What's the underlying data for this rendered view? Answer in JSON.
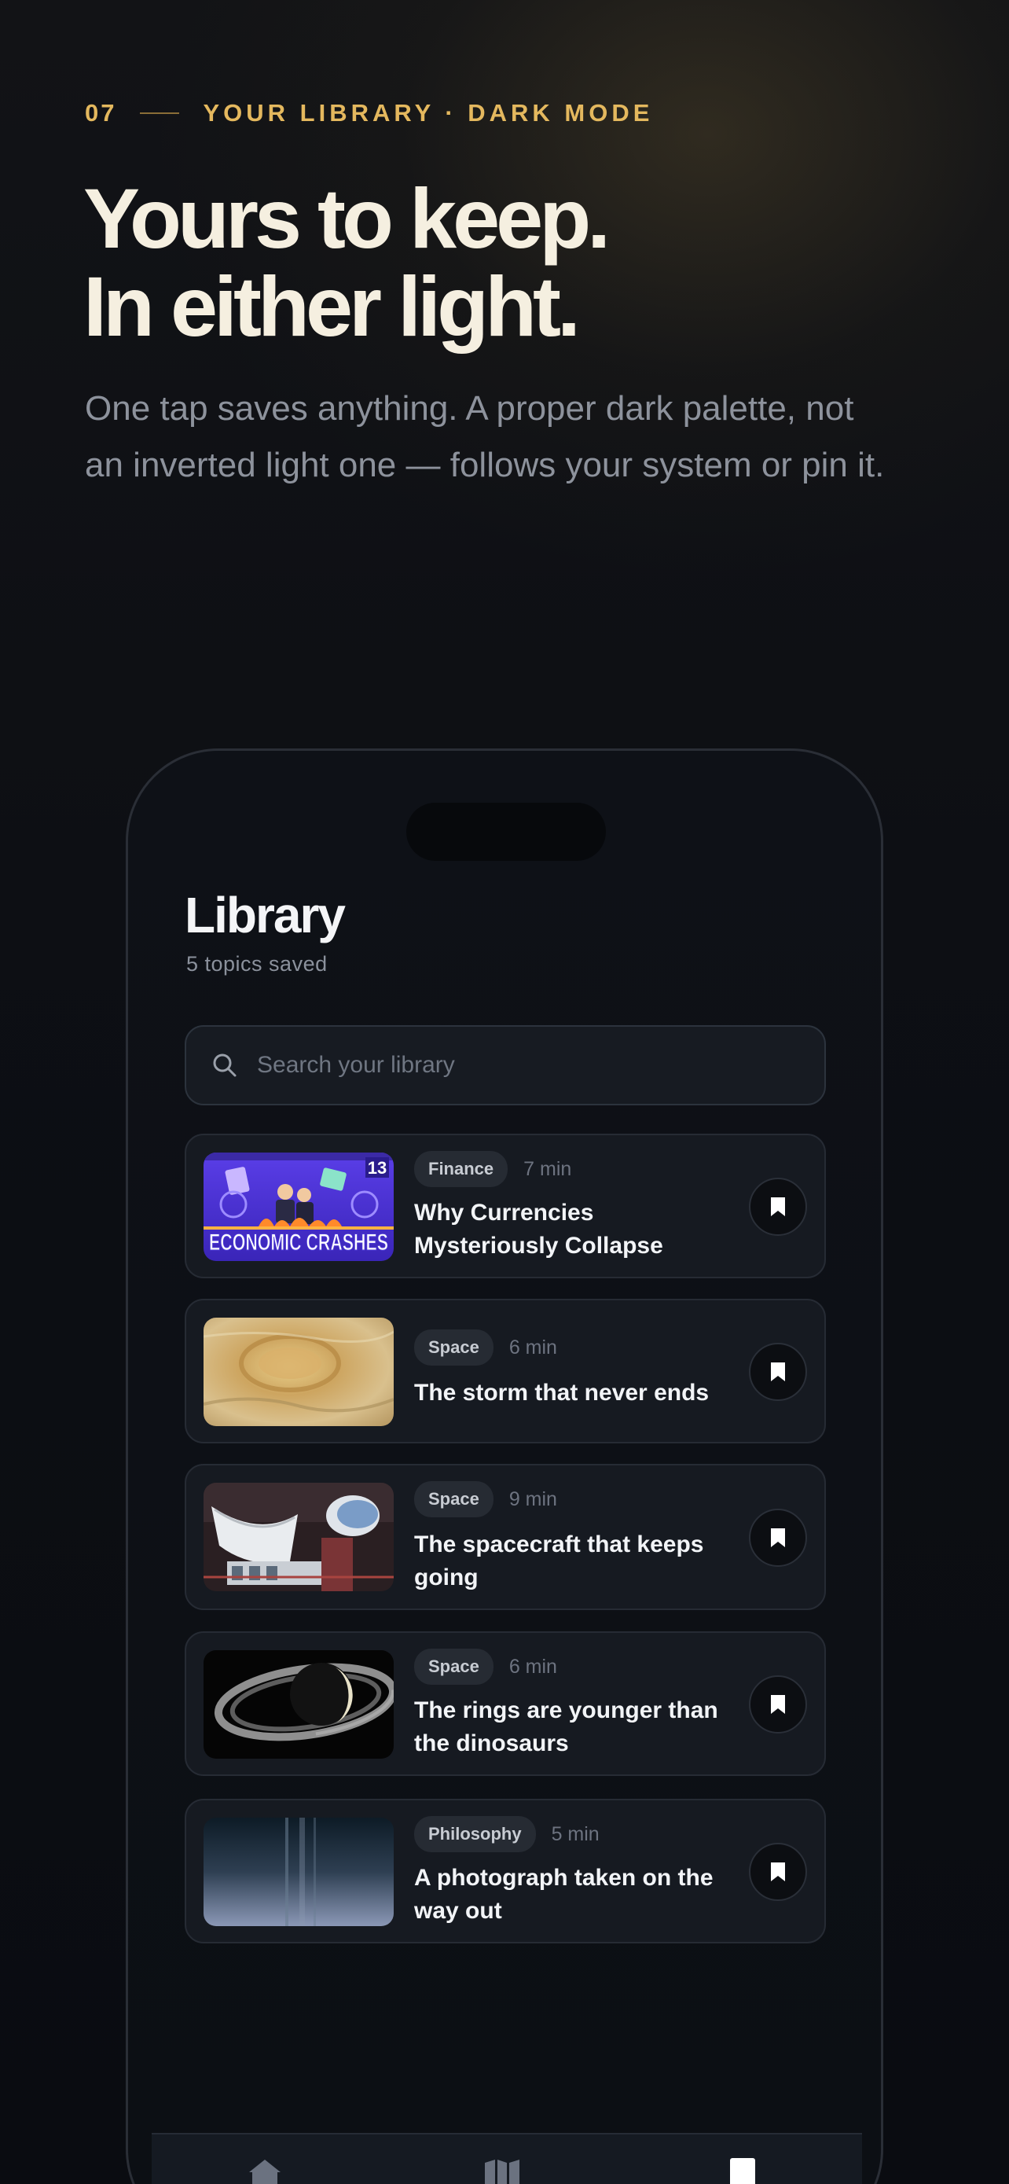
{
  "hero": {
    "step": "07",
    "eyebrow": "YOUR LIBRARY · DARK MODE",
    "headline_line1": "Yours to keep.",
    "headline_line2": "In either light.",
    "subtitle_line1": "One tap saves anything. A proper dark palette, not",
    "subtitle_line2": "an inverted light one — follows your system or pin it."
  },
  "library": {
    "title": "Library",
    "count": "5 topics saved",
    "search_placeholder": "Search your library",
    "items": [
      {
        "tag": "Finance",
        "duration": "7 min",
        "title": "Why Currencies Mysteriously Collapse",
        "thumb_text": "ECONOMIC CRASHES",
        "thumb_badge": "13",
        "bookmark": "bookmark-icon"
      },
      {
        "tag": "Space",
        "duration": "6 min",
        "title": "The storm that never ends",
        "bookmark": "bookmark-icon"
      },
      {
        "tag": "Space",
        "duration": "9 min",
        "title": "The spacecraft that keeps going",
        "bookmark": "bookmark-icon"
      },
      {
        "tag": "Space",
        "duration": "6 min",
        "title": "The rings are younger than the dinosaurs",
        "bookmark": "bookmark-icon"
      },
      {
        "tag": "Philosophy",
        "duration": "5 min",
        "title": "A photograph taken on the way out",
        "bookmark": "bookmark-icon"
      }
    ]
  },
  "tabbar": {
    "tabs": [
      {
        "icon": "home-icon",
        "active": false
      },
      {
        "icon": "map-icon",
        "active": false
      },
      {
        "icon": "book-icon",
        "active": true
      }
    ]
  },
  "colors": {
    "accent": "#e4b85e",
    "headline": "#f5efe0",
    "background": "#0b0d12",
    "card": "#161a21"
  }
}
